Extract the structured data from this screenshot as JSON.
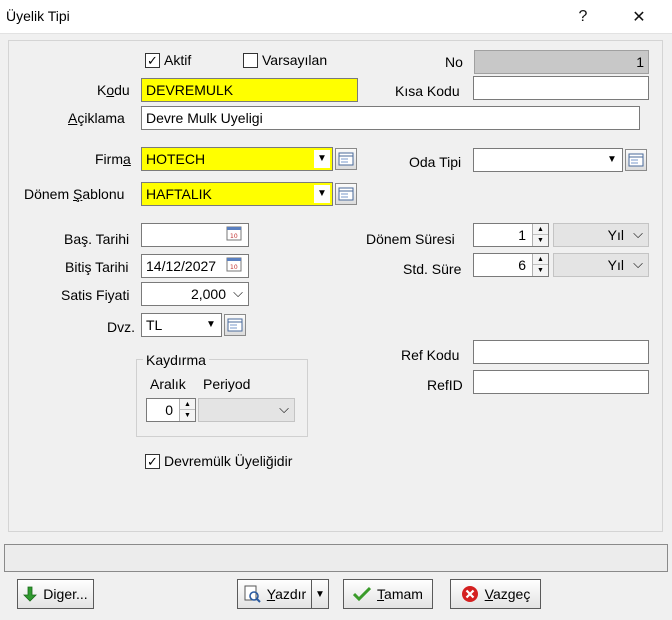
{
  "window": {
    "title": "Üyelik Tipi",
    "help_label": "?",
    "close_label": "✕"
  },
  "form": {
    "aktif": {
      "label": "Aktif",
      "checked": true
    },
    "varsayilan": {
      "label": "Varsayılan",
      "checked": false
    },
    "no": {
      "label": "No",
      "value": "1"
    },
    "kodu": {
      "label_pre": "K",
      "label_u": "o",
      "label_post": "du",
      "value": "DEVREMULK"
    },
    "kisa_kodu": {
      "label": "Kısa Kodu",
      "value": ""
    },
    "aciklama": {
      "label_u": "A",
      "label_post": "çiklama",
      "value": "Devre Mulk Uyeligi"
    },
    "firma": {
      "label_pre": "Firm",
      "label_u": "a",
      "value": "HOTECH"
    },
    "oda_tipi": {
      "label": "Oda Tipi",
      "value": ""
    },
    "donem_sablonu": {
      "label_pre": "Dönem ",
      "label_u": "Ş",
      "label_post": "ablonu",
      "value": "HAFTALIK"
    },
    "bas_tarihi": {
      "label": "Baş. Tarihi",
      "value": ""
    },
    "bitis_tarihi": {
      "label": "Bitiş Tarihi",
      "value": "14/12/2027"
    },
    "satis_fiyati": {
      "label": "Satis Fiyati",
      "value": "2,000"
    },
    "dvz": {
      "label": "Dvz.",
      "value": "TL"
    },
    "donem_suresi": {
      "label": "Dönem Süresi",
      "value": "1",
      "unit": "Yıl"
    },
    "std_sure": {
      "label": "Std. Süre",
      "value": "6",
      "unit": "Yıl"
    },
    "kaydirma": {
      "title": "Kaydırma",
      "aralik_label": "Aralık",
      "periyod_label": "Periyod",
      "aralik_value": "0",
      "periyod_value": ""
    },
    "ref_kodu": {
      "label": "Ref Kodu",
      "value": ""
    },
    "ref_id": {
      "label": "RefID",
      "value": ""
    },
    "devremulk": {
      "label": "Devremülk Üyeliğidir",
      "checked": true
    }
  },
  "buttons": {
    "diger": {
      "label_pre": "Di",
      "label_u": "g",
      "label_post": "er..."
    },
    "yazdir": {
      "label_u": "Y",
      "label_post": "azdır"
    },
    "tamam": {
      "label_u": "T",
      "label_post": "amam"
    },
    "vazgec": {
      "label_u": "V",
      "label_post": "azgeç"
    }
  },
  "symbols": {
    "check": "✓",
    "dropdown": "▼",
    "chevron": "⌵",
    "up": "▲",
    "down": "▼"
  },
  "colors": {
    "required_field": "#ffff00",
    "readonly_field": "#c8c8c8",
    "ok_green": "#3a9b2a",
    "cancel_red": "#d42020"
  }
}
